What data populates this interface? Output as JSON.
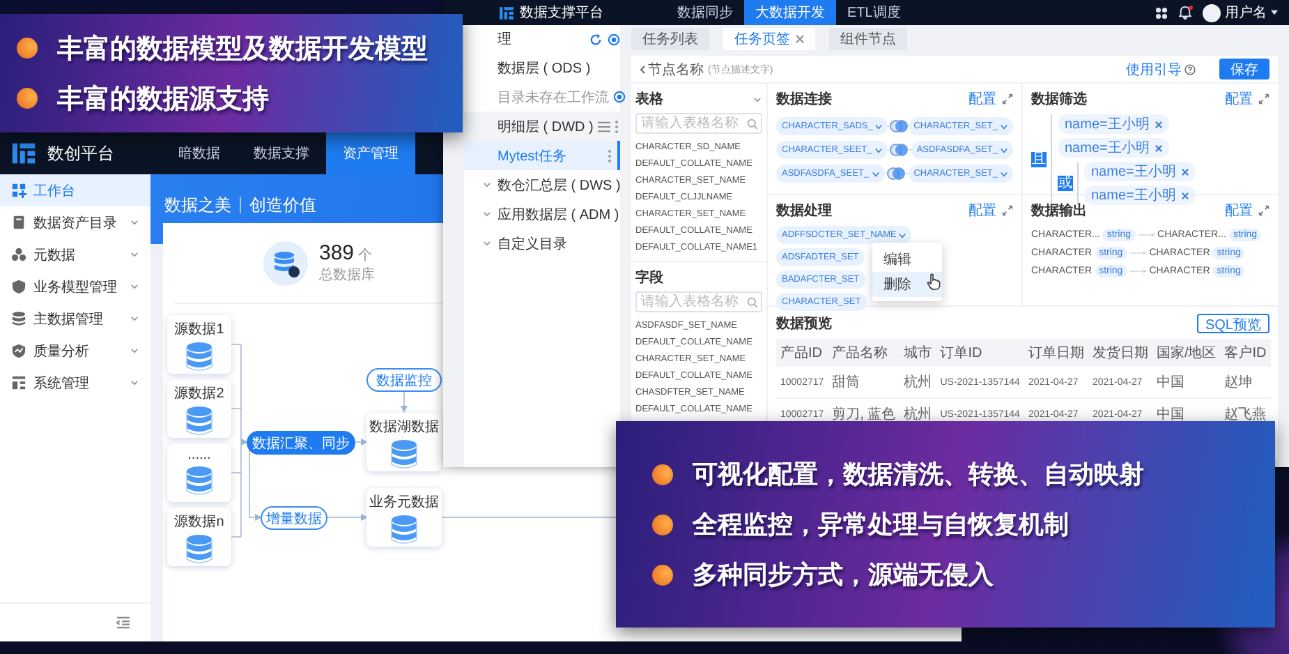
{
  "banners": [
    {
      "points": [
        "丰富的数据模型及数据开发模型",
        "丰富的数据源支持"
      ]
    },
    {
      "points": [
        "可视化配置，数据清洗、转换、自动映射",
        "全程监控，异常处理与自恢复机制",
        "多种同步方式，源端无侵入"
      ]
    }
  ],
  "asset_window": {
    "brand": "数创平台",
    "nav": [
      {
        "label": "暗数据",
        "selected": false
      },
      {
        "label": "数据支撑",
        "selected": false
      },
      {
        "label": "资产管理",
        "selected": true
      }
    ],
    "sidebar": [
      {
        "label": "工作台",
        "kind": "workbench",
        "selected": true,
        "expandable": false
      },
      {
        "label": "数据资产目录",
        "kind": "catalog",
        "selected": false,
        "expandable": true
      },
      {
        "label": "元数据",
        "kind": "metadata",
        "selected": false,
        "expandable": true
      },
      {
        "label": "业务模型管理",
        "kind": "model",
        "selected": false,
        "expandable": true
      },
      {
        "label": "主数据管理",
        "kind": "master",
        "selected": false,
        "expandable": true
      },
      {
        "label": "质量分析",
        "kind": "quality",
        "selected": false,
        "expandable": true
      },
      {
        "label": "系统管理",
        "kind": "system",
        "selected": false,
        "expandable": true
      }
    ],
    "hero": {
      "title": "数据之美",
      "subtitle": "创造价值"
    },
    "stat": {
      "value": "389",
      "unit": "个",
      "label": "总数据库"
    },
    "flow": {
      "sources": [
        "源数据1",
        "源数据2",
        "......",
        "源数据n"
      ],
      "sync": "数据汇聚、同步",
      "monitor": "数据监控",
      "lake": "数据湖数据",
      "increment": "增量数据",
      "business": "业务元数据"
    }
  },
  "dev_window": {
    "title": "数据支撑平台",
    "nav": [
      {
        "label": "数据同步",
        "selected": false
      },
      {
        "label": "大数据开发",
        "selected": true
      },
      {
        "label": "ETL调度",
        "selected": false
      }
    ],
    "has_notification": true,
    "user": "用户名",
    "tree_header": "理",
    "tree": [
      {
        "label": "数据层 ( ODS )",
        "hovered": false,
        "children": [
          {
            "label": "目录未存在工作流",
            "kind": "draft",
            "selected": false
          }
        ]
      },
      {
        "label": "明细层 ( DWD )",
        "hovered": true,
        "children": [
          {
            "label": "Mytest任务",
            "kind": "task",
            "selected": true
          }
        ]
      },
      {
        "label": "数仓汇总层 ( DWS )",
        "hovered": false
      },
      {
        "label": "应用数据层 ( ADM )",
        "hovered": false
      },
      {
        "label": "自定义目录",
        "hovered": false
      }
    ],
    "tabs": [
      {
        "label": "任务列表",
        "selected": false,
        "closable": false
      },
      {
        "label": "任务页签",
        "selected": true,
        "closable": true
      },
      {
        "label": "组件节点",
        "selected": false,
        "closable": false
      }
    ],
    "node": {
      "name": "节点名称",
      "description": "(节点描述文字)"
    },
    "guide": "使用引导",
    "save": "保存",
    "tables": {
      "title": "表格",
      "placeholder": "请输入表格名称",
      "items": [
        "CHARACTER_SD_NAME",
        "DEFAULT_COLLATE_NAME",
        "CHARACTER_SET_NAME",
        "DEFAULT_CLJJLNAME",
        "CHARACTER_SET_NAME",
        "DEFAULT_COLLATE_NAME",
        "DEFAULT_COLLATE_NAME1"
      ]
    },
    "fields": {
      "title": "字段",
      "placeholder": "请输入表格名称",
      "items": [
        "ASDFASDF_SET_NAME",
        "DEFAULT_COLLATE_NAME",
        "CHARACTER_SET_NAME",
        "DEFAULT_COLLATE_NAME",
        "CHASDFTER_SET_NAME",
        "DEFAULT_COLLATE_NAME"
      ]
    },
    "join": {
      "title": "数据连接",
      "action": "配置",
      "rows": [
        {
          "left": "CHARACTER_SADS_",
          "right": "CHARACTER_SET_"
        },
        {
          "left": "CHARACTER_SEET_",
          "right": "ASDFASDFA_SET_"
        },
        {
          "left": "ASDFASDFA_SEET_",
          "right": "CHARACTER_SET_"
        }
      ]
    },
    "filter": {
      "title": "数据筛选",
      "action": "配置",
      "operator": "且",
      "conditions": [
        "name=王小明",
        "name=王小明"
      ],
      "group": {
        "operator": "或",
        "conditions": [
          "name=王小明",
          "name=王小明"
        ]
      }
    },
    "process": {
      "title": "数据处理",
      "action": "配置",
      "items": [
        {
          "label": "ADFFSDCTER_SET_NAME",
          "open": true
        },
        {
          "label": "ADSFADTER_SET",
          "open": false
        },
        {
          "label": "BADAFCTER_SET",
          "open": false
        },
        {
          "label": "CHARACTER_SET",
          "open": false
        }
      ],
      "menu": [
        {
          "label": "编辑",
          "selected": false
        },
        {
          "label": "删除",
          "selected": true
        }
      ]
    },
    "output": {
      "title": "数据输出",
      "action": "配置",
      "rows": [
        {
          "source": "CHARACTER...",
          "source_type": "string",
          "target": "CHARACTER...",
          "target_type": "string"
        },
        {
          "source": "CHARACTER",
          "source_type": "string",
          "target": "CHARACTER",
          "target_type": "string"
        },
        {
          "source": "CHARACTER",
          "source_type": "string",
          "target": "CHARACTER",
          "target_type": "string"
        }
      ]
    },
    "preview": {
      "title": "数据预览",
      "sql_button": "SQL预览",
      "columns": [
        "产品ID",
        "产品名称",
        "城市",
        "订单ID",
        "订单日期",
        "发货日期",
        "国家/地区",
        "客户ID"
      ],
      "rows": [
        [
          "10002717",
          "甜筒",
          "杭州",
          "US-2021-1357144",
          "2021-04-27",
          "2021-04-27",
          "中国",
          "赵坤"
        ],
        [
          "10002717",
          "剪刀, 蓝色",
          "杭州",
          "US-2021-1357144",
          "2021-04-27",
          "2021-04-27",
          "中国",
          "赵飞燕"
        ]
      ]
    }
  }
}
